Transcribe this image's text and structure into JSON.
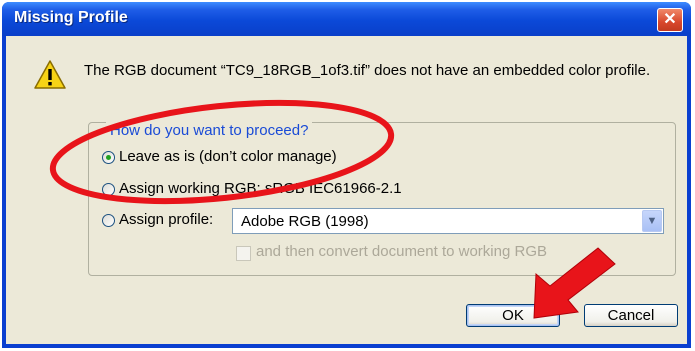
{
  "window": {
    "title": "Missing Profile",
    "close_glyph": "✕"
  },
  "message": "The RGB document “TC9_18RGB_1of3.tif” does not have an embedded color profile.",
  "icons": {
    "warning": "warning-icon",
    "close": "close-icon",
    "dropdown": "chevron-down-icon"
  },
  "proceed": {
    "legend": "How do you want to proceed?",
    "options": [
      {
        "label": "Leave as is (don’t color manage)",
        "selected": true
      },
      {
        "label": "Assign working RGB:  sRGB IEC61966-2.1",
        "selected": false
      },
      {
        "label": "Assign profile:",
        "selected": false
      }
    ],
    "profile_select_value": "Adobe RGB (1998)",
    "convert_checkbox_label": "and then convert document to working RGB",
    "convert_checked": false,
    "convert_enabled": false
  },
  "buttons": {
    "ok": "OK",
    "cancel": "Cancel"
  },
  "colors": {
    "titlebar": "#0b49d8",
    "client_bg": "#ece9d8",
    "legend_text": "#1a4bd6",
    "annotation_red": "#e8141a"
  },
  "annotations": [
    "red-ellipse-around-leave-as-is",
    "red-arrow-pointing-to-ok"
  ]
}
